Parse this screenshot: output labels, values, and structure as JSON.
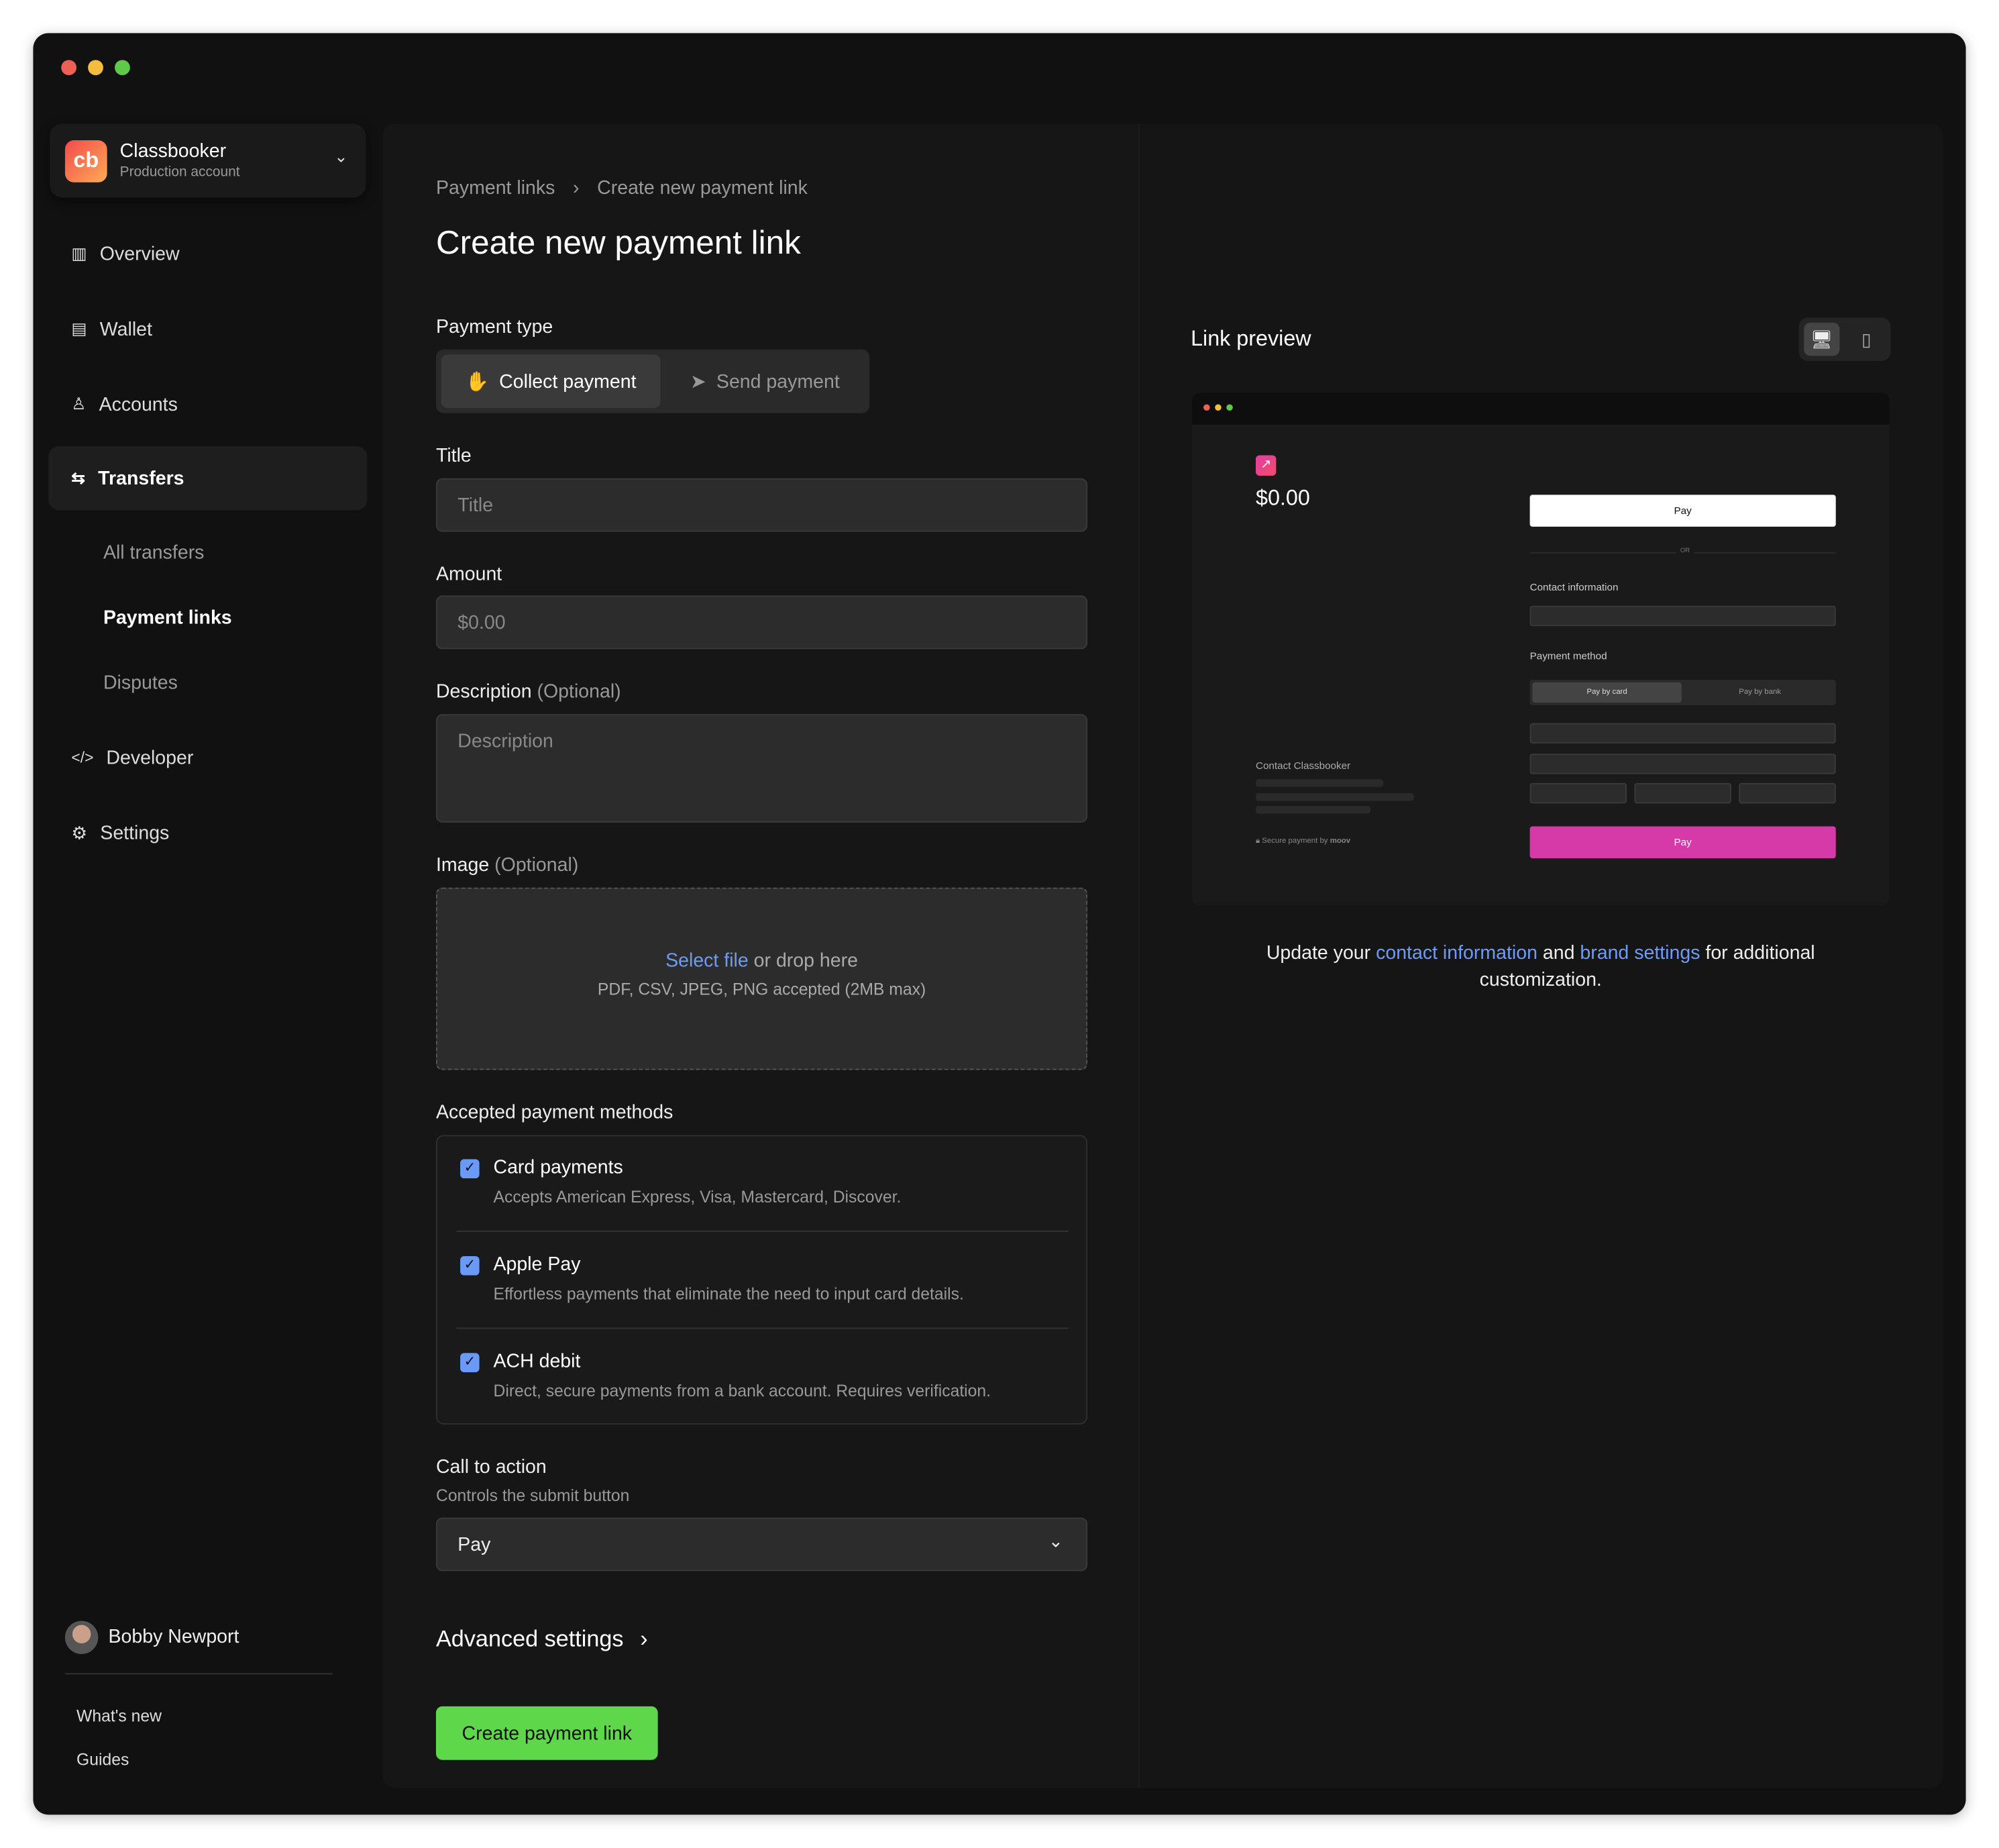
{
  "account": {
    "name": "Classbooker",
    "subtitle": "Production account",
    "logo": "cb"
  },
  "sidebar": {
    "items": [
      {
        "label": "Overview",
        "icon": "layout-icon"
      },
      {
        "label": "Wallet",
        "icon": "wallet-icon"
      },
      {
        "label": "Accounts",
        "icon": "user-icon"
      },
      {
        "label": "Transfers",
        "icon": "transfers-icon",
        "active": true
      },
      {
        "label": "Developer",
        "icon": "code-icon"
      },
      {
        "label": "Settings",
        "icon": "gear-icon"
      }
    ],
    "sub_items": [
      "All transfers",
      "Payment links",
      "Disputes"
    ],
    "user": "Bobby Newport",
    "footer": [
      "What's new",
      "Guides"
    ]
  },
  "breadcrumb": [
    "Payment links",
    "Create new payment link"
  ],
  "page_title": "Create new payment link",
  "form": {
    "payment_type_label": "Payment type",
    "payment_types": [
      "Collect payment",
      "Send payment"
    ],
    "title_label": "Title",
    "title_placeholder": "Title",
    "amount_label": "Amount",
    "amount_placeholder": "$0.00",
    "description_label": "Description",
    "optional": "(Optional)",
    "description_placeholder": "Description",
    "image_label": "Image",
    "select_file": "Select file",
    "drop_here": "or drop here",
    "file_hint": "PDF, CSV, JPEG, PNG accepted (2MB max)",
    "methods_label": "Accepted payment methods",
    "methods": [
      {
        "title": "Card payments",
        "desc": "Accepts American Express, Visa, Mastercard, Discover.",
        "checked": true
      },
      {
        "title": "Apple Pay",
        "desc": "Effortless payments that eliminate the need to input card details.",
        "checked": true
      },
      {
        "title": "ACH debit",
        "desc": "Direct, secure payments from a bank account. Requires verification.",
        "checked": true
      }
    ],
    "cta_label": "Call to action",
    "cta_hint": "Controls the submit button",
    "cta_value": "Pay",
    "advanced": "Advanced settings",
    "submit": "Create payment link"
  },
  "preview": {
    "title": "Link preview",
    "amount": "$0.00",
    "apple_pay": "Pay",
    "or": "OR",
    "contact_info": "Contact information",
    "payment_method": "Payment method",
    "pay_by_card": "Pay by card",
    "pay_by_bank": "Pay by bank",
    "pay": "Pay",
    "contact": "Contact Classbooker",
    "secure": "Secure payment by",
    "brand": "moov",
    "note_1": "Update your",
    "link_1": "contact information",
    "note_2": "and",
    "link_2": "brand settings",
    "note_3": "for additional customization."
  },
  "colors": {
    "accent": "#6d9cf7",
    "submit": "#5ed84a",
    "pay": "#d63aa8"
  }
}
